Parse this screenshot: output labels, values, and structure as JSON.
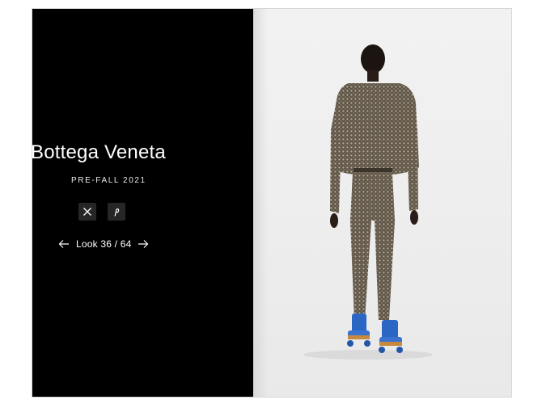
{
  "lookbook": {
    "brand": "Bottega Veneta",
    "season": "PRE-FALL 2021",
    "counter": "Look 36 / 64"
  },
  "share": {
    "x_icon": "x-logo-icon",
    "pinterest_icon": "pinterest-icon"
  },
  "nav": {
    "prev_icon": "arrow-left-icon",
    "next_icon": "arrow-right-icon"
  },
  "colors": {
    "panel_bg": "#000000",
    "text": "#ffffff",
    "button_bg": "#262626",
    "photo_bg": "#ededed",
    "outfit": "#8a7a63",
    "skates": "#2c66c4"
  }
}
